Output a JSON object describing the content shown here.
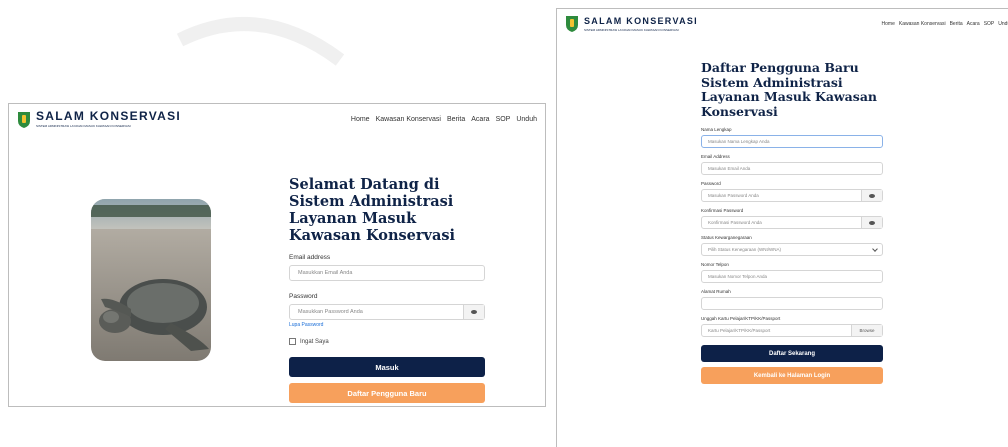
{
  "brand": {
    "name": "SALAM KONSERVASI",
    "tagline": "SISTEM ADMINISTRASI LAYANAN MASUK KAWASAN KONSERVASI"
  },
  "nav": [
    "Home",
    "Kawasan Konservasi",
    "Berita",
    "Acara",
    "SOP",
    "Unduh"
  ],
  "login": {
    "title": "Selamat Datang di Sistem Administrasi Layanan Masuk Kawasan Konservasi",
    "email_label": "Email address",
    "email_placeholder": "Masukkan Email Anda",
    "password_label": "Password",
    "password_placeholder": "Masukkan Password Anda",
    "forgot_link": "Lupa Password",
    "remember_label": "Ingat Saya",
    "submit_label": "Masuk",
    "register_label": "Daftar Pengguna Baru"
  },
  "register": {
    "title": "Daftar Pengguna Baru Sistem Administrasi Layanan Masuk Kawasan Konservasi",
    "fields": [
      {
        "label": "Nama Lengkap",
        "placeholder": "Masukan Nama Lengkap Anda"
      },
      {
        "label": "Email Address",
        "placeholder": "Masukan Email Anda"
      },
      {
        "label": "Password",
        "placeholder": "Masukan Password Anda"
      },
      {
        "label": "Konfirmasi Password",
        "placeholder": "Konfirmasi Password Anda"
      },
      {
        "label": "Status Kewarganegaraan",
        "placeholder": "Pilih Status Kenegaraan (WNI/WNA)"
      },
      {
        "label": "Nomor Telpon",
        "placeholder": "Masukan Nomor Telpon Anda"
      },
      {
        "label": "Alamat Rumah",
        "placeholder": ""
      },
      {
        "label": "Unggah Kartu Pelajar/KTP/KK/Passport",
        "placeholder": "Kartu Pelajar/KTP/KK/Passport"
      }
    ],
    "browse_label": "Browse",
    "submit_label": "Daftar Sekarang",
    "back_label": "Kembali ke Halaman Login"
  },
  "colors": {
    "navy": "#0d2148",
    "orange": "#f7a05c",
    "link": "#1a6ed8"
  },
  "icons": [
    "shield-logo-icon",
    "eye-icon",
    "chevron-down-icon"
  ]
}
